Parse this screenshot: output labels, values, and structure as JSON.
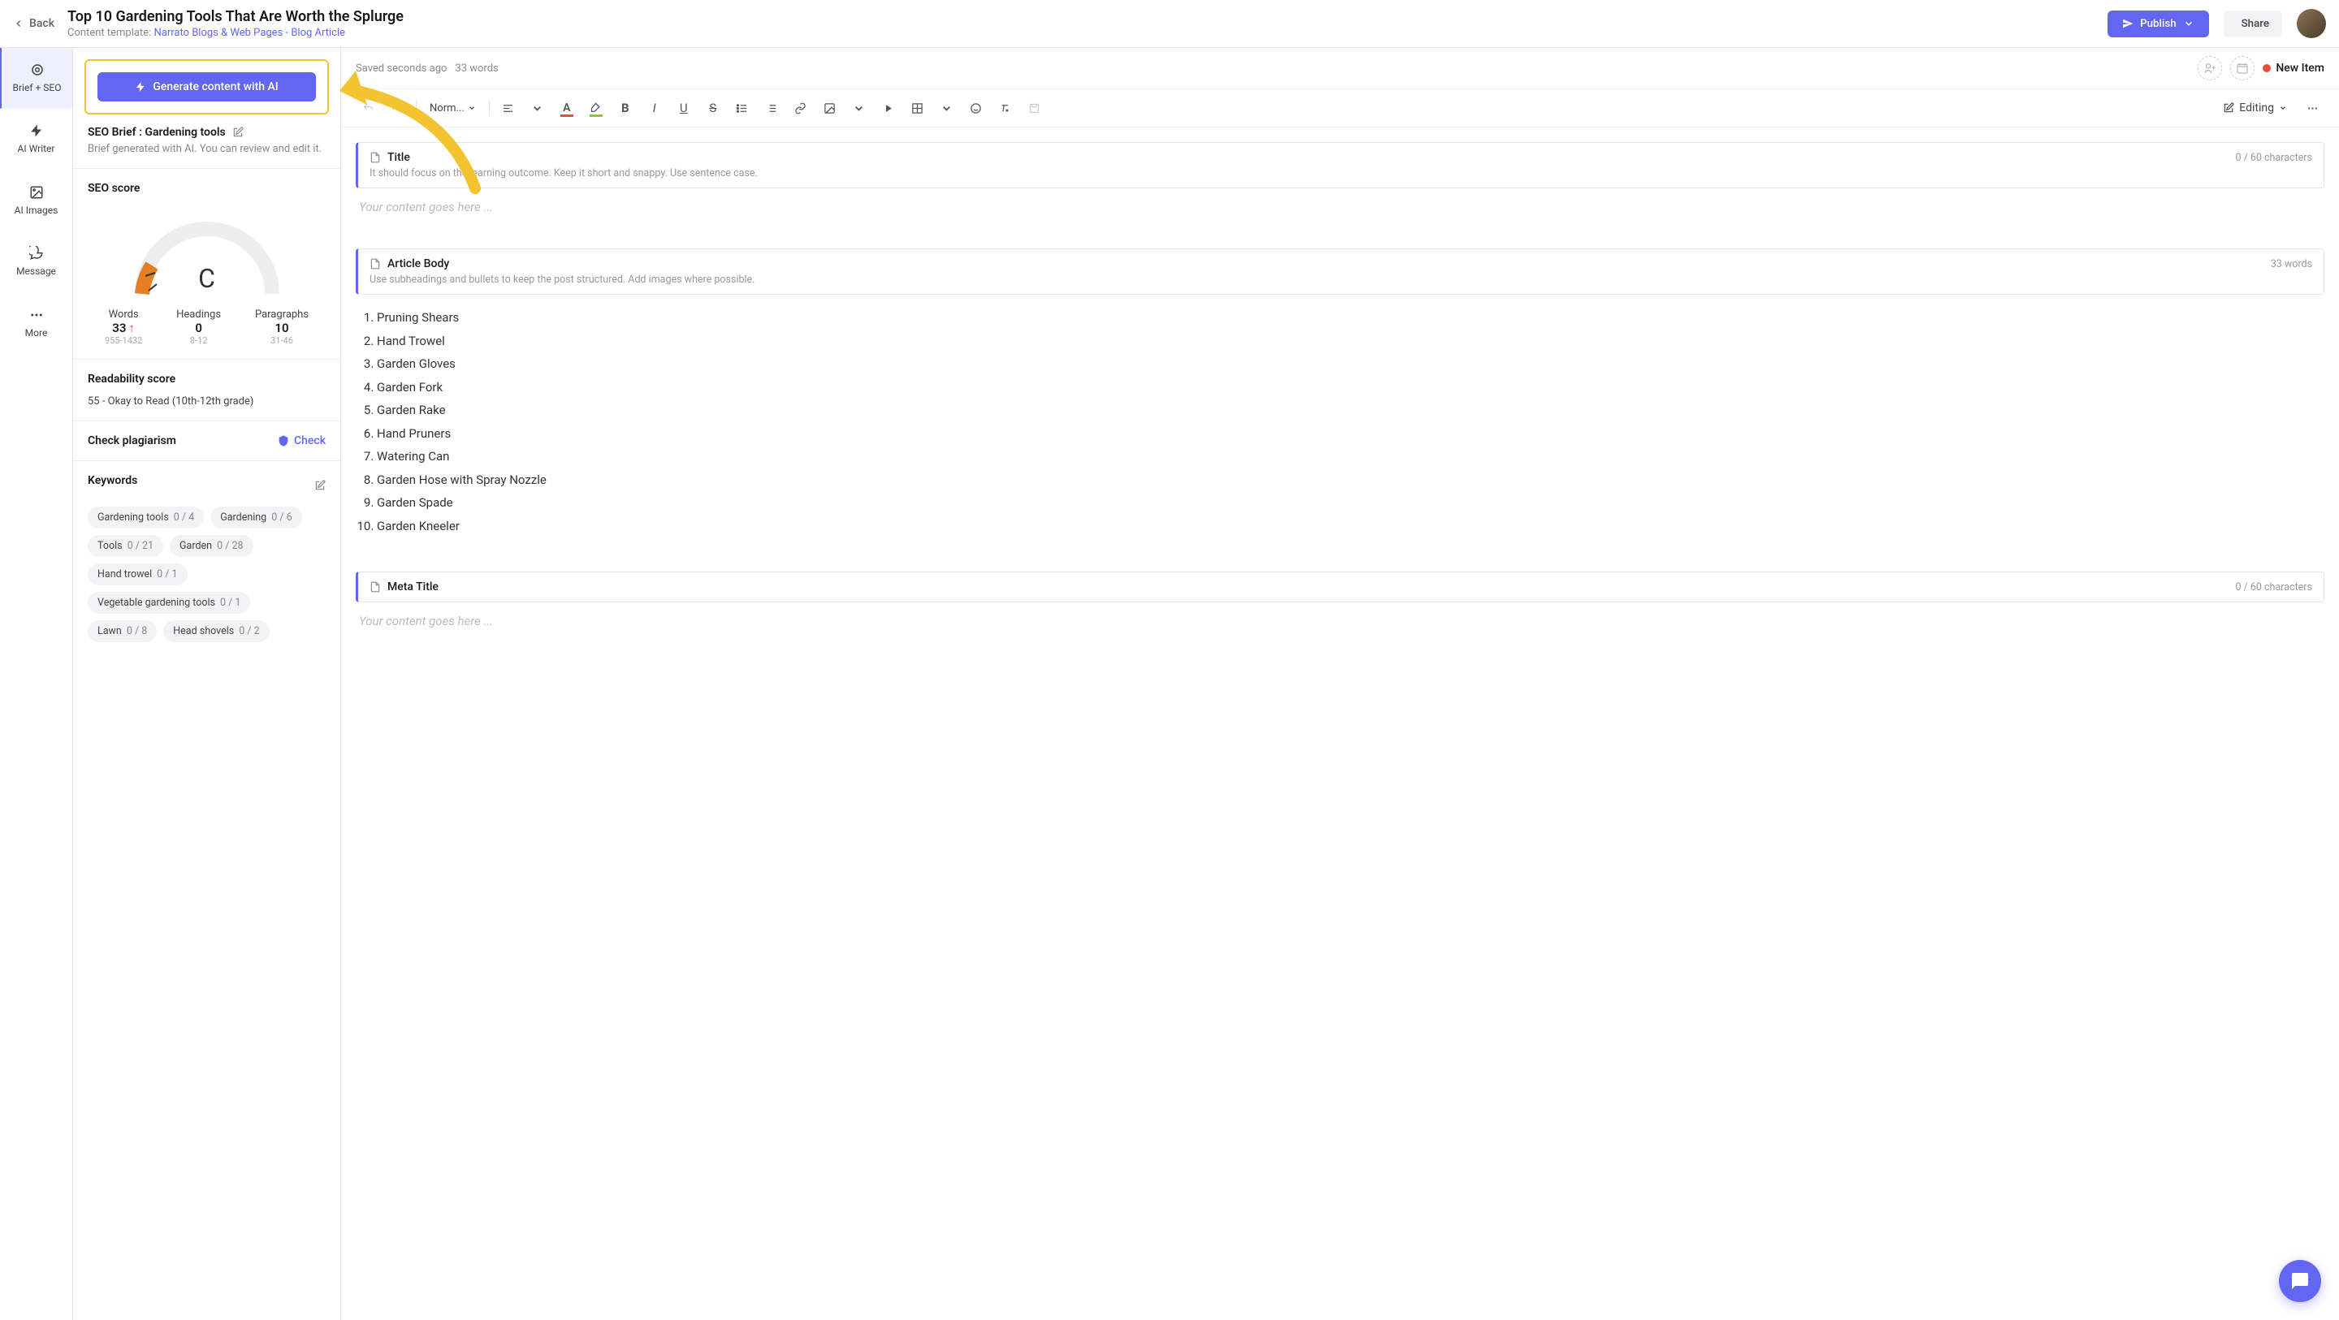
{
  "header": {
    "back": "Back",
    "title": "Top 10 Gardening Tools That Are Worth the Splurge",
    "template_label": "Content template:",
    "template_link": "Narrato Blogs & Web Pages - Blog Article",
    "publish": "Publish",
    "share": "Share"
  },
  "rail": {
    "brief_seo": "Brief + SEO",
    "ai_writer": "AI Writer",
    "ai_images": "AI Images",
    "message": "Message",
    "more": "More"
  },
  "sidebar": {
    "generate_btn": "Generate content with AI",
    "brief_title": "SEO Brief : Gardening tools",
    "brief_desc": "Brief generated with AI. You can review and edit it.",
    "seo_score_title": "SEO score",
    "gauge_grade": "C",
    "metrics": {
      "words_label": "Words",
      "words_val": "33",
      "words_range": "955-1432",
      "head_label": "Headings",
      "head_val": "0",
      "head_range": "8-12",
      "para_label": "Paragraphs",
      "para_val": "10",
      "para_range": "31-46"
    },
    "readability_title": "Readability score",
    "readability_val": "55 - Okay to Read (10th-12th grade)",
    "plagiarism_title": "Check plagiarism",
    "check_btn": "Check",
    "keywords_title": "Keywords",
    "keywords": [
      {
        "label": "Gardening tools",
        "count": "0 / 4"
      },
      {
        "label": "Gardening",
        "count": "0 / 6"
      },
      {
        "label": "Tools",
        "count": "0 / 21"
      },
      {
        "label": "Garden",
        "count": "0 / 28"
      },
      {
        "label": "Hand trowel",
        "count": "0 / 1"
      },
      {
        "label": "Vegetable gardening tools",
        "count": "0 / 1"
      },
      {
        "label": "Lawn",
        "count": "0 / 8"
      },
      {
        "label": "Head shovels",
        "count": "0 / 2"
      }
    ]
  },
  "editor_top": {
    "saved": "Saved seconds ago",
    "word_count": "33 words",
    "new_item": "New Item",
    "heading_select": "Norm...",
    "editing": "Editing"
  },
  "blocks": {
    "title": {
      "label": "Title",
      "meta": "0 / 60 characters",
      "desc": "It should focus on the learning outcome. Keep it short and snappy. Use sentence case.",
      "placeholder": "Your content goes here ..."
    },
    "body": {
      "label": "Article Body",
      "meta": "33 words",
      "desc": "Use subheadings and bullets to keep the post structured. Add images where possible.",
      "items": [
        "Pruning Shears",
        "Hand Trowel",
        "Garden Gloves",
        "Garden Fork",
        "Garden Rake",
        "Hand Pruners",
        "Watering Can",
        "Garden Hose with Spray Nozzle",
        "Garden Spade",
        "Garden Kneeler"
      ]
    },
    "meta_title": {
      "label": "Meta Title",
      "meta": "0 / 60 characters",
      "placeholder": "Your content goes here ..."
    }
  }
}
